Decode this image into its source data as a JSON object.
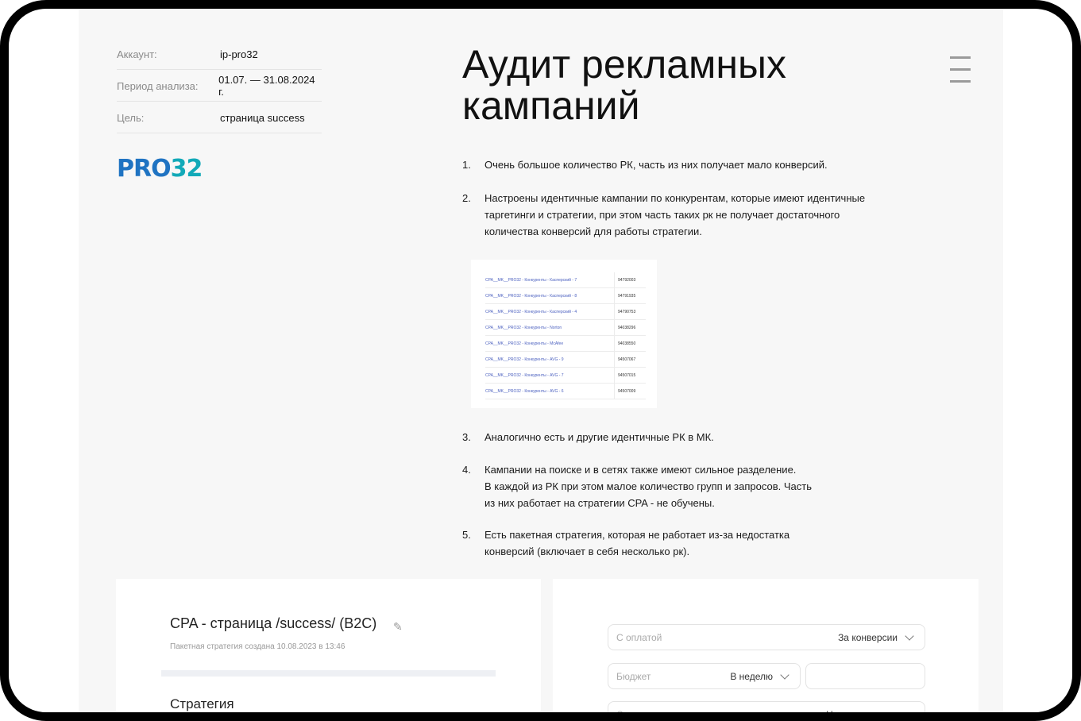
{
  "meta": {
    "account_label": "Аккаунт:",
    "account_value": "ip-pro32",
    "period_label": "Период анализа:",
    "period_value": "01.07. — 31.08.2024 г.",
    "goal_label": "Цель:",
    "goal_value": "страница success"
  },
  "logo": {
    "part1": "PRO",
    "part2": "32",
    "color_primary": "#1f73c2",
    "color_secondary": "#12a9b8"
  },
  "title_line1": "Аудит рекламных",
  "title_line2": "кампаний",
  "menu_icon": "hamburger-icon",
  "list": [
    {
      "num": "1.",
      "text": "Очень большое количество РК, часть из них получает мало конверсий."
    },
    {
      "num": "2.",
      "text": "Настроены идентичные кампании по конкурентам, которые имеют идентичные\nтаргетинги и стратегии, при этом часть таких рк не получает достаточного\nколичества конверсий для работы стратегии."
    },
    {
      "num": "3.",
      "text": "Аналогично есть и другие идентичные РК в МК."
    },
    {
      "num": "4.",
      "text": "Кампании на поиске и в сетях также имеют сильное разделение.\nВ каждой из РК при этом малое количество групп и запросов. Часть\nиз них работает на стратегии CPA - не обучены."
    },
    {
      "num": "5.",
      "text": "Есть пакетная стратегия, которая не работает из-за недостатка\nконверсий (включает в себя несколько рк)."
    }
  ],
  "thumbnail_rows": [
    {
      "name": "CPA__MK__PRO32 - Конкуренты - Касперский - 7",
      "id": "94792003"
    },
    {
      "name": "CPA__MK__PRO32 - Конкуренты - Касперский - 8",
      "id": "94791935"
    },
    {
      "name": "CPA__MK__PRO32 - Конкуренты - Касперский - 4",
      "id": "94790753"
    },
    {
      "name": "CPA__MK__PRO32 - Конкуренты - Norton",
      "id": "94038296"
    },
    {
      "name": "CPA__MK__PRO32 - Конкуренты - McAfee",
      "id": "94038550"
    },
    {
      "name": "CPA__MK__PRO32 - Конкуренты - AVG - 9",
      "id": "94507067"
    },
    {
      "name": "CPA__MK__PRO32 - Конкуренты - AVG - 7",
      "id": "94507015"
    },
    {
      "name": "CPA__MK__PRO32 - Конкуренты - AVG - 6",
      "id": "94507009"
    }
  ],
  "strategy_card": {
    "title": "CPA - страница /success/ (B2C)",
    "subtitle": "Пакетная стратегия создана 10.08.2023 в 13:46",
    "section": "Стратегия",
    "edit_icon": "pencil-icon"
  },
  "settings_card": {
    "payment_label": "С оплатой",
    "payment_value": "За конверсии",
    "budget_label": "Бюджет",
    "budget_value": "В неделю",
    "limit_label": "Ограничение расхода",
    "limit_value": "Цена конверсии"
  }
}
